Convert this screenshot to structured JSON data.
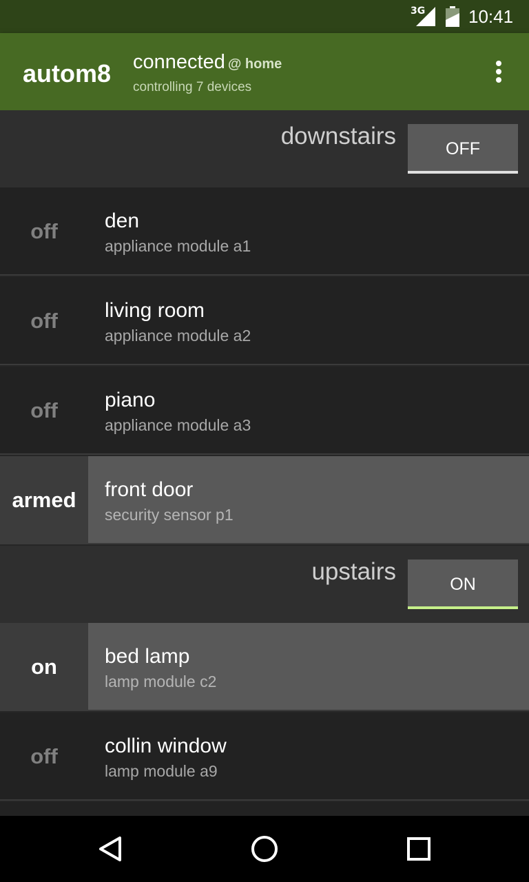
{
  "status_bar": {
    "network": "3G",
    "time": "10:41",
    "icons": [
      "signal-icon",
      "battery-icon"
    ]
  },
  "app_bar": {
    "title": "autom8",
    "connection_status": "connected",
    "connection_at": "@ home",
    "subtitle": "controlling 7 devices",
    "overflow_icon": "more-vert-icon"
  },
  "groups": [
    {
      "name": "downstairs",
      "toggle_label": "OFF",
      "toggle_indicator_color": "#e0e0e0",
      "devices": [
        {
          "state": "off",
          "name": "den",
          "description": "appliance module a1",
          "active": false
        },
        {
          "state": "off",
          "name": "living room",
          "description": "appliance module a2",
          "active": false
        },
        {
          "state": "off",
          "name": "piano",
          "description": "appliance module a3",
          "active": false
        },
        {
          "state": "armed",
          "name": "front door",
          "description": "security sensor p1",
          "active": true
        }
      ]
    },
    {
      "name": "upstairs",
      "toggle_label": "ON",
      "toggle_indicator_color": "#c6f08a",
      "devices": [
        {
          "state": "on",
          "name": "bed lamp",
          "description": "lamp module c2",
          "active": true
        },
        {
          "state": "off",
          "name": "collin window",
          "description": "lamp module a9",
          "active": false
        }
      ]
    }
  ],
  "nav_bar": {
    "icons": [
      "back-icon",
      "home-icon",
      "recents-icon"
    ]
  },
  "colors": {
    "app_bar": "#476a23",
    "status_bar": "#2e4418",
    "on_indicator": "#c6f08a"
  }
}
